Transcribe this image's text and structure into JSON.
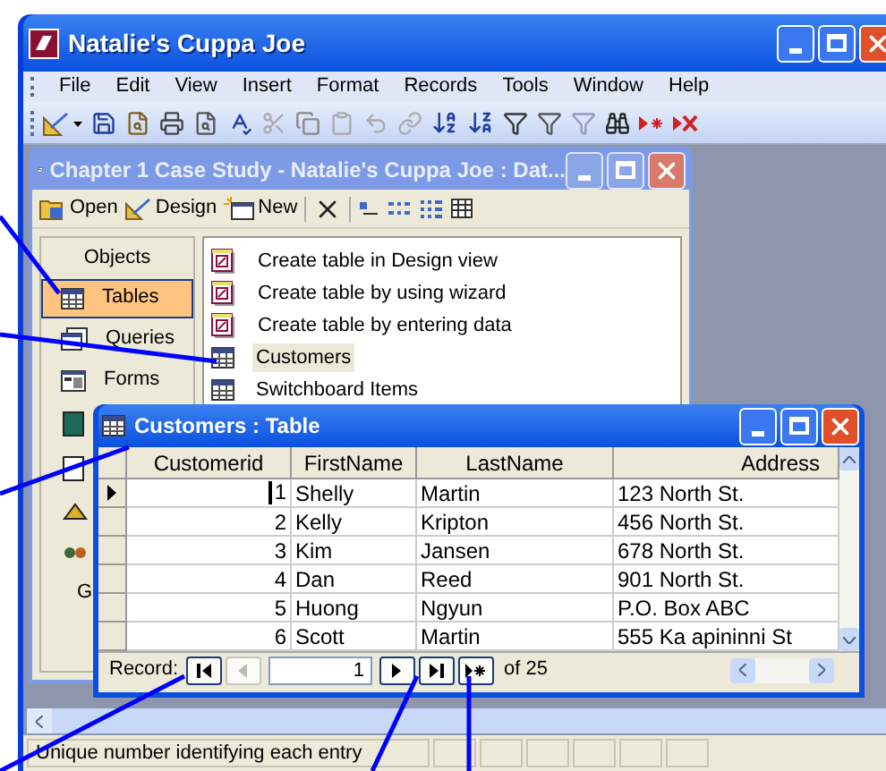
{
  "app_window": {
    "title": "Natalie's Cuppa Joe"
  },
  "menu": [
    {
      "label": "File"
    },
    {
      "label": "Edit"
    },
    {
      "label": "View"
    },
    {
      "label": "Insert"
    },
    {
      "label": "Format"
    },
    {
      "label": "Records"
    },
    {
      "label": "Tools"
    },
    {
      "label": "Window"
    },
    {
      "label": "Help"
    }
  ],
  "database_window": {
    "title": "Chapter 1 Case Study - Natalie's Cuppa Joe : Dat...",
    "toolbar": [
      {
        "label": "Open",
        "kind": "open"
      },
      {
        "label": "Design",
        "kind": "design"
      },
      {
        "label": "New",
        "kind": "new"
      }
    ],
    "objects_header": "Objects",
    "objects": [
      {
        "label": "Tables",
        "kind": "table",
        "selected": true
      },
      {
        "label": "Queries",
        "kind": "query",
        "selected": false
      },
      {
        "label": "Forms",
        "kind": "form",
        "selected": false
      }
    ],
    "groups_label": "G",
    "items": [
      {
        "label": "Create table in Design view",
        "kind": "shortcut",
        "selected": false
      },
      {
        "label": "Create table by using wizard",
        "kind": "shortcut",
        "selected": false
      },
      {
        "label": "Create table by entering data",
        "kind": "shortcut",
        "selected": false
      },
      {
        "label": "Customers",
        "kind": "table",
        "selected": true
      },
      {
        "label": "Switchboard Items",
        "kind": "table",
        "selected": false
      }
    ]
  },
  "table_window": {
    "title": "Customers : Table",
    "columns": [
      "Customerid",
      "FirstName",
      "LastName",
      "Address"
    ],
    "rows": [
      {
        "cells": [
          "1",
          "Shelly",
          "Martin",
          "123 North St."
        ],
        "current": true
      },
      {
        "cells": [
          "2",
          "Kelly",
          "Kripton",
          "456 North St."
        ],
        "current": false
      },
      {
        "cells": [
          "3",
          "Kim",
          "Jansen",
          "678 North St."
        ],
        "current": false
      },
      {
        "cells": [
          "4",
          "Dan",
          "Reed",
          "901 North St."
        ],
        "current": false
      },
      {
        "cells": [
          "5",
          "Huong",
          "Ngyun",
          "P.O. Box ABC"
        ],
        "current": false
      },
      {
        "cells": [
          "6",
          "Scott",
          "Martin",
          "555 Ka apininni St"
        ],
        "current": false
      }
    ],
    "navigator": {
      "label": "Record:",
      "value": "1",
      "total": "of 25"
    }
  },
  "status_bar": {
    "text": "Unique number identifying each entry"
  }
}
